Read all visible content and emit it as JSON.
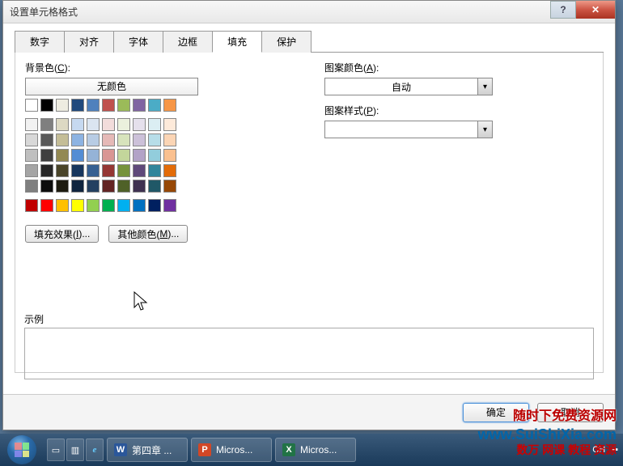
{
  "dialog": {
    "title": "设置单元格格式",
    "tabs": [
      "数字",
      "对齐",
      "字体",
      "边框",
      "填充",
      "保护"
    ],
    "active_tab_index": 4,
    "fill": {
      "bgcolor_label": "背景色(C):",
      "no_color": "无颜色",
      "pattern_color_label": "图案颜色(A):",
      "pattern_color_value": "自动",
      "pattern_style_label": "图案样式(P):",
      "pattern_style_value": "",
      "fill_effects_btn": "填充效果(I)...",
      "other_colors_btn": "其他颜色(M)...",
      "example_label": "示例",
      "theme_row": [
        "#ffffff",
        "#000000",
        "#eeece1",
        "#1f497d",
        "#4f81bd",
        "#c0504d",
        "#9bbb59",
        "#8064a2",
        "#4bacc6",
        "#f79646"
      ],
      "tint_rows": [
        [
          "#f2f2f2",
          "#7f7f7f",
          "#ddd9c3",
          "#c6d9f0",
          "#dbe5f1",
          "#f2dcdb",
          "#ebf1dd",
          "#e5e0ec",
          "#dbeef3",
          "#fdeada"
        ],
        [
          "#d8d8d8",
          "#595959",
          "#c4bd97",
          "#8db3e2",
          "#b8cce4",
          "#e5b9b7",
          "#d7e3bc",
          "#ccc1d9",
          "#b7dde8",
          "#fbd5b5"
        ],
        [
          "#bfbfbf",
          "#3f3f3f",
          "#938953",
          "#548dd4",
          "#95b3d7",
          "#d99694",
          "#c3d69b",
          "#b2a2c7",
          "#92cddc",
          "#fac08f"
        ],
        [
          "#a5a5a5",
          "#262626",
          "#494429",
          "#17365d",
          "#366092",
          "#953734",
          "#76923c",
          "#5f497a",
          "#31859b",
          "#e36c09"
        ],
        [
          "#7f7f7f",
          "#0c0c0c",
          "#1d1b10",
          "#0f243e",
          "#244061",
          "#632423",
          "#4f6128",
          "#3f3151",
          "#205867",
          "#974806"
        ]
      ],
      "standard_row": [
        "#c00000",
        "#ff0000",
        "#ffc000",
        "#ffff00",
        "#92d050",
        "#00b050",
        "#00b0f0",
        "#0070c0",
        "#002060",
        "#7030a0"
      ]
    },
    "ok_btn": "确定",
    "cancel_btn": "取消"
  },
  "taskbar": {
    "items": [
      {
        "icon": "W",
        "label": "第四章 ..."
      },
      {
        "icon": "P",
        "label": "Micros..."
      },
      {
        "icon": "X",
        "label": "Micros..."
      }
    ],
    "tray_lang": "CH"
  },
  "watermarks": {
    "line1": "随时下免费资源网",
    "line2": "www.SuiShiXia.com",
    "line3": "数万 网课 教程 资源"
  }
}
